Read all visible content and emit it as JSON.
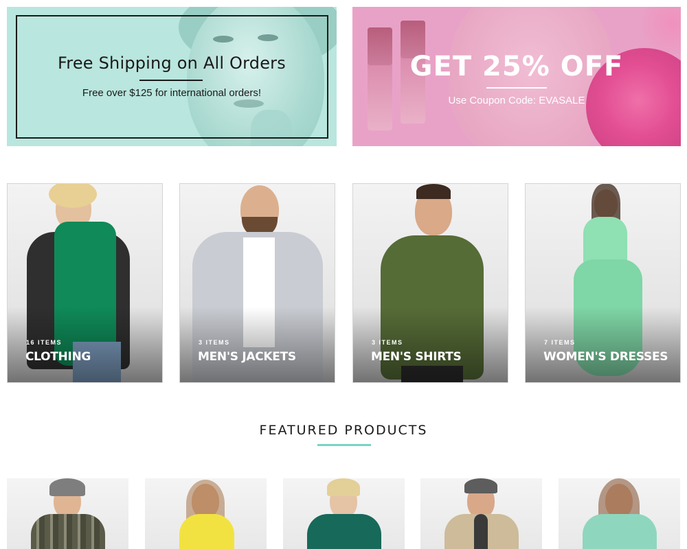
{
  "promo_shipping": {
    "title": "Free Shipping on All Orders",
    "subtitle": "Free over $125 for international orders!",
    "background": "#b9e6de"
  },
  "promo_sale": {
    "title": "GET 25% OFF",
    "subtitle": "Use Coupon Code: EVASALE",
    "background": "#e9a2c7"
  },
  "categories": [
    {
      "count": "16 ITEMS",
      "name": "CLOTHING"
    },
    {
      "count": "3 ITEMS",
      "name": "MEN'S JACKETS"
    },
    {
      "count": "3 ITEMS",
      "name": "MEN'S SHIRTS"
    },
    {
      "count": "7 ITEMS",
      "name": "WOMEN'S DRESSES"
    }
  ],
  "featured": {
    "title": "FEATURED PRODUCTS",
    "accent": "#78d3c3"
  },
  "products": [
    {
      "image": "model-plaid-shirt-beanie"
    },
    {
      "image": "model-yellow-top"
    },
    {
      "image": "model-green-sweater"
    },
    {
      "image": "model-fleece-jacket"
    },
    {
      "image": "model-mint-coat"
    }
  ]
}
